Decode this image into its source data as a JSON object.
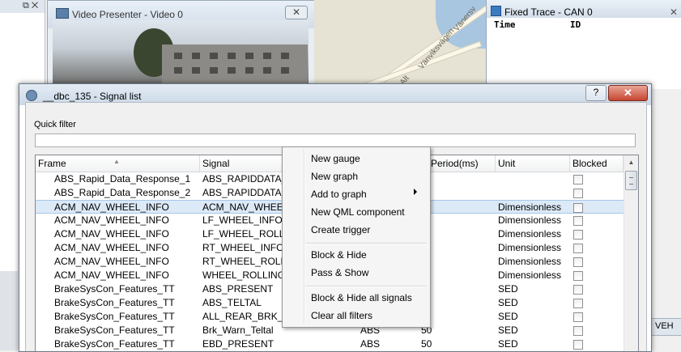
{
  "background": {
    "video_presenter": {
      "title": "Video Presenter - Video 0",
      "close_glyph": "✕"
    },
    "map": {
      "labels": [
        "Vänersv",
        "Vänviksvägen",
        "Alt"
      ]
    },
    "fixed_trace": {
      "title": "Fixed Trace - CAN 0",
      "columns": [
        "Time",
        "ID"
      ],
      "close_glyph": "✕"
    },
    "left_panel": {
      "glyphs": "⧉ ✕"
    },
    "veh_tab": "VEH"
  },
  "dialog": {
    "title": "__dbc_135 - Signal list",
    "help_label": "?",
    "close_label": "✕",
    "quick_filter_label": "Quick filter",
    "quick_filter_value": "",
    "columns": [
      "Frame",
      "Signal",
      "",
      "Period(ms)",
      "Unit",
      "Blocked"
    ],
    "rows": [
      {
        "frame": "ABS_Rapid_Data_Response_1",
        "signal": "ABS_RAPIDDATA_R",
        "sender": "",
        "period": "",
        "unit": "",
        "blocked": false
      },
      {
        "frame": "ABS_Rapid_Data_Response_2",
        "signal": "ABS_RAPIDDATA_R",
        "sender": "",
        "period": "",
        "unit": "",
        "blocked": false
      },
      {
        "frame": "ACM_NAV_WHEEL_INFO",
        "signal": "ACM_NAV_WHEEL_",
        "sender": "",
        "period": "",
        "unit": "Dimensionless",
        "blocked": false,
        "selected": true
      },
      {
        "frame": "ACM_NAV_WHEEL_INFO",
        "signal": "LF_WHEEL_INFO_S",
        "sender": "",
        "period": "",
        "unit": "Dimensionless",
        "blocked": false
      },
      {
        "frame": "ACM_NAV_WHEEL_INFO",
        "signal": "LF_WHEEL_ROLLIN",
        "sender": "",
        "period": "",
        "unit": "Dimensionless",
        "blocked": false
      },
      {
        "frame": "ACM_NAV_WHEEL_INFO",
        "signal": "RT_WHEEL_INFO_S",
        "sender": "",
        "period": "",
        "unit": "Dimensionless",
        "blocked": false
      },
      {
        "frame": "ACM_NAV_WHEEL_INFO",
        "signal": "RT_WHEEL_ROLLIN",
        "sender": "",
        "period": "",
        "unit": "Dimensionless",
        "blocked": false
      },
      {
        "frame": "ACM_NAV_WHEEL_INFO",
        "signal": "WHEEL_ROLLING_T",
        "sender": "",
        "period": "",
        "unit": "Dimensionless",
        "blocked": false
      },
      {
        "frame": "BrakeSysCon_Features_TT",
        "signal": "ABS_PRESENT",
        "sender": "",
        "period": "",
        "unit": "SED",
        "blocked": false
      },
      {
        "frame": "BrakeSysCon_Features_TT",
        "signal": "ABS_TELTAL",
        "sender": "",
        "period": "",
        "unit": "SED",
        "blocked": false
      },
      {
        "frame": "BrakeSysCon_Features_TT",
        "signal": "ALL_REAR_BRK_LM",
        "sender": "",
        "period": "",
        "unit": "SED",
        "blocked": false
      },
      {
        "frame": "BrakeSysCon_Features_TT",
        "signal": "Brk_Warn_Teltal",
        "sender": "ABS",
        "period": "50",
        "unit": "SED",
        "blocked": false
      },
      {
        "frame": "BrakeSysCon_Features_TT",
        "signal": "EBD_PRESENT",
        "sender": "ABS",
        "period": "50",
        "unit": "SED",
        "blocked": false
      }
    ]
  },
  "context_menu": {
    "items": [
      {
        "label": "New gauge"
      },
      {
        "label": "New graph"
      },
      {
        "label": "Add to graph",
        "submenu": true
      },
      {
        "label": "New QML component"
      },
      {
        "label": "Create trigger"
      },
      {
        "label": "Block & Hide"
      },
      {
        "label": "Pass & Show"
      },
      {
        "label": "Block & Hide all signals"
      },
      {
        "label": "Clear all filters"
      }
    ]
  },
  "colors": {
    "selection": "#dce9f7",
    "close_button": "#c74530"
  }
}
